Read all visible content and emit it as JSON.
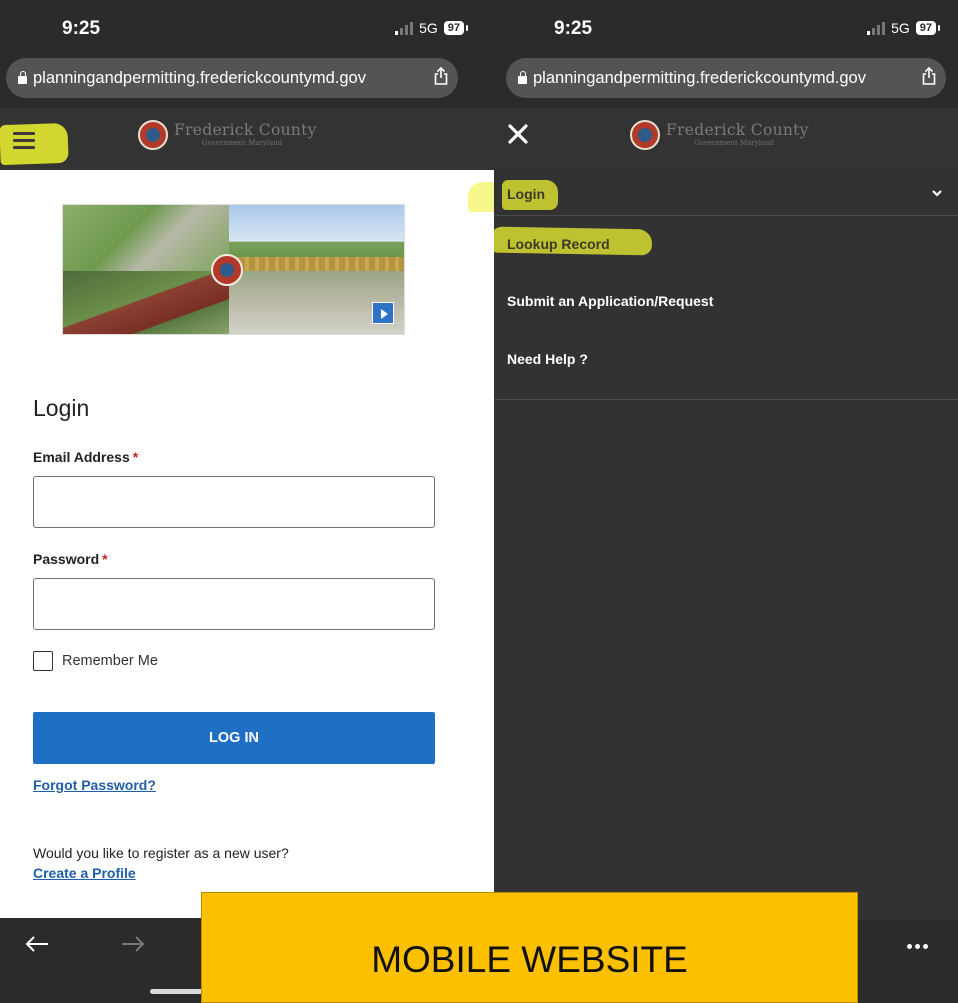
{
  "left_screen": {
    "status": {
      "time": "9:25",
      "network": "5G",
      "battery": "97"
    },
    "browser": {
      "url": "planningandpermitting.frederickcountymd.gov"
    },
    "header": {
      "brand_name": "Frederick County",
      "brand_sub": "Government Maryland"
    },
    "login": {
      "title": "Login",
      "email_label": "Email Address",
      "email_value": "",
      "password_label": "Password",
      "password_value": "",
      "required_mark": "*",
      "remember_label": "Remember Me",
      "remember_checked": false,
      "login_button": "LOG IN",
      "forgot_link": "Forgot Password?",
      "register_question": "Would you like to register as a new user?",
      "create_profile_link": "Create a Profile"
    }
  },
  "right_screen": {
    "status": {
      "time": "9:25",
      "network": "5G",
      "battery": "97"
    },
    "browser": {
      "url": "planningandpermitting.frederickcountymd.gov"
    },
    "header": {
      "brand_name": "Frederick County",
      "brand_sub": "Government Maryland"
    },
    "menu": {
      "items": [
        {
          "label": "Login",
          "expandable": true,
          "highlighted": true
        },
        {
          "label": "Lookup Record",
          "highlighted": true
        },
        {
          "label": "Submit an Application/Request"
        },
        {
          "label": "Need Help ?"
        }
      ]
    }
  },
  "caption": {
    "text": "MOBILE WEBSITE"
  },
  "colors": {
    "highlight": "#f0f32e",
    "primary_button": "#1f6fc4",
    "link": "#1f5ea8",
    "caption_bg": "#fcc000",
    "menu_bg": "#323232"
  }
}
